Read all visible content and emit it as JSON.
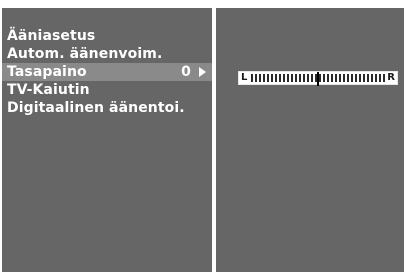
{
  "menu": {
    "items": [
      {
        "label": "Ääniasetus",
        "value": "",
        "selected": false,
        "has_arrow": false
      },
      {
        "label": "Autom. äänenvoim.",
        "value": "",
        "selected": false,
        "has_arrow": false
      },
      {
        "label": "Tasapaino",
        "value": "0",
        "selected": true,
        "has_arrow": true
      },
      {
        "label": "TV-Kaiutin",
        "value": "",
        "selected": false,
        "has_arrow": false
      },
      {
        "label": "Digitaalinen äänentoi.",
        "value": "",
        "selected": false,
        "has_arrow": false
      }
    ]
  },
  "balance": {
    "left_label": "L",
    "right_label": "R",
    "level": 0,
    "min": -50,
    "max": 50
  },
  "icons": {
    "arrow": "arrow-right-icon"
  },
  "colors": {
    "panel_bg": "#666666",
    "selected_bg": "#8a8a8a",
    "text": "#ffffff",
    "frame": "#ffffff"
  }
}
